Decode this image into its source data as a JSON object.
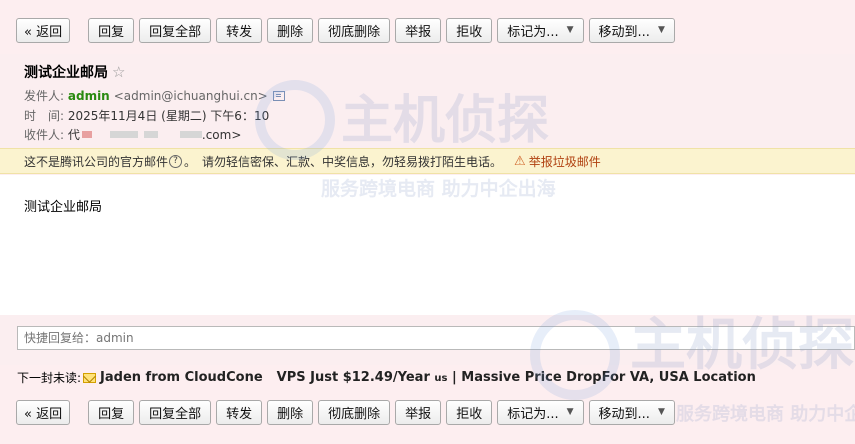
{
  "toolbar": {
    "back": "« 返回",
    "reply": "回复",
    "reply_all": "回复全部",
    "forward": "转发",
    "delete": "删除",
    "delete_permanently": "彻底删除",
    "report": "举报",
    "reject": "拒收",
    "mark_as": "标记为...",
    "move_to": "移动到..."
  },
  "mail": {
    "subject": "测试企业邮局",
    "sender_label": "发件人:",
    "sender_name": "admin",
    "sender_address": "<admin@ichuanghui.cn>",
    "time_label": "时　间:",
    "time_value": "2025年11月4日 (星期二) 下午6：10",
    "recipient_label": "收件人:",
    "recipient_prefix": "代",
    "recipient_suffix": ".com>"
  },
  "notice": {
    "text_part1": "这不是腾讯公司的官方邮件",
    "text_part2": "。　请勿轻信密保、汇款、中奖信息，勿轻易拨打陌生电话。",
    "report_spam": "举报垃圾邮件"
  },
  "body": {
    "text": "测试企业邮局"
  },
  "quick_reply": {
    "placeholder": "快捷回复给：admin"
  },
  "next_mail": {
    "label": "下一封未读:",
    "sender": "Jaden from CloudCone",
    "subject_part1": "VPS Just $12.49/Year",
    "subject_small": "us",
    "subject_part2": "| Massive Price DropFor VA, USA Location"
  },
  "watermark": {
    "brand": "主机侦探",
    "slogan": "服务跨境电商 助力中企出海"
  },
  "icons": {
    "star": "star-icon",
    "contact_card": "contact-card-icon",
    "question": "question-icon",
    "report": "report-icon",
    "envelope": "envelope-icon",
    "caret": "chevron-down-icon"
  }
}
